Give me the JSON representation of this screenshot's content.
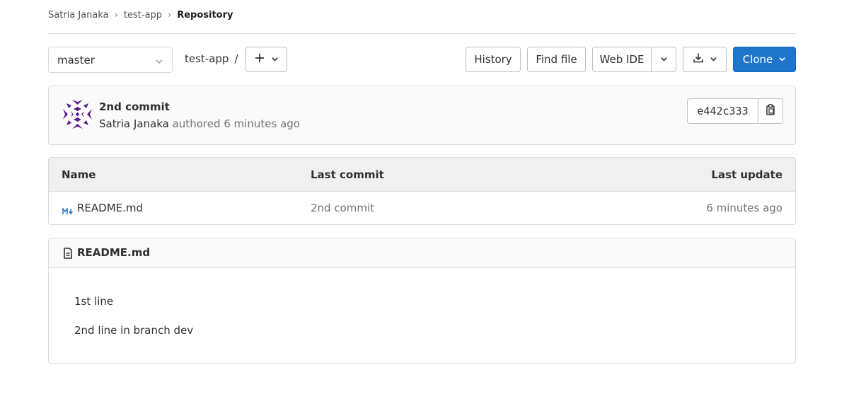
{
  "breadcrumb": {
    "items": [
      "Satria Janaka",
      "test-app",
      "Repository"
    ]
  },
  "toolbar": {
    "branch": "master",
    "path": "test-app",
    "path_separator": "/",
    "history_label": "History",
    "find_file_label": "Find file",
    "web_ide_label": "Web IDE",
    "clone_label": "Clone",
    "accent_color": "#1f75cb"
  },
  "commit": {
    "title": "2nd commit",
    "author": "Satria Janaka",
    "meta": "authored 6 minutes ago",
    "sha": "e442c333",
    "avatar_color": "#5b1c8e"
  },
  "files": {
    "columns": [
      "Name",
      "Last commit",
      "Last update"
    ],
    "rows": [
      {
        "icon": "markdown-icon",
        "name": "README.md",
        "last_commit": "2nd commit",
        "last_update": "6 minutes ago"
      }
    ]
  },
  "readme": {
    "filename": "README.md",
    "lines": [
      "1st line",
      "2nd line in branch dev"
    ]
  },
  "icons": {
    "breadcrumb_separator": "chevron-right-icon",
    "branch_dropdown": "chevron-down-icon",
    "add": "plus-icon",
    "download": "download-icon",
    "copy": "clipboard-icon",
    "readme": "document-icon"
  }
}
